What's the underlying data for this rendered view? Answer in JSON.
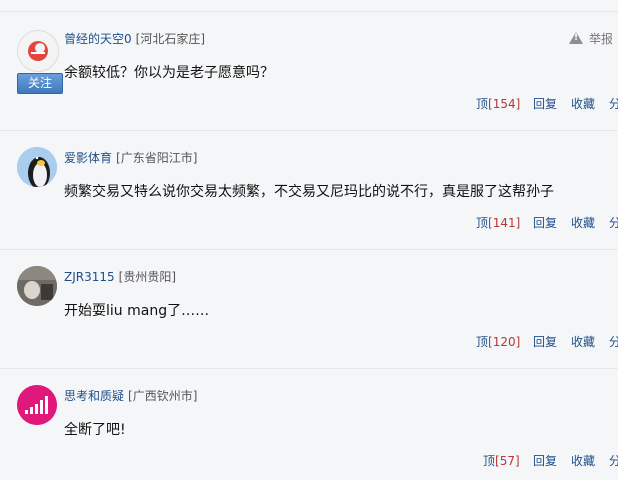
{
  "report_label": "举报",
  "follow_label": "关注",
  "comments": [
    {
      "user": "曾经的天空0",
      "location": "[河北石家庄]",
      "text": "余额较低？你以为是老子愿意吗？",
      "up_label": "顶",
      "up_count": "[154]",
      "reply": "回复",
      "fav": "收藏",
      "share": "分"
    },
    {
      "user": "爱影体育",
      "location": "[广东省阳江市]",
      "text": "频繁交易又特么说你交易太频繁，不交易又尼玛比的说不行，真是服了这帮孙子",
      "up_label": "顶",
      "up_count": "[141]",
      "reply": "回复",
      "fav": "收藏",
      "share": "分"
    },
    {
      "user": "ZJR3115",
      "location": "[贵州贵阳]",
      "text": "开始耍liu mang了……",
      "up_label": "顶",
      "up_count": "[120]",
      "reply": "回复",
      "fav": "收藏",
      "share": "分"
    },
    {
      "user": "思考和质疑",
      "location": "[广西钦州市]",
      "text": "全断了吧!",
      "up_label": "顶",
      "up_count": "[57]",
      "reply": "回复",
      "fav": "收藏",
      "share": "分"
    }
  ]
}
